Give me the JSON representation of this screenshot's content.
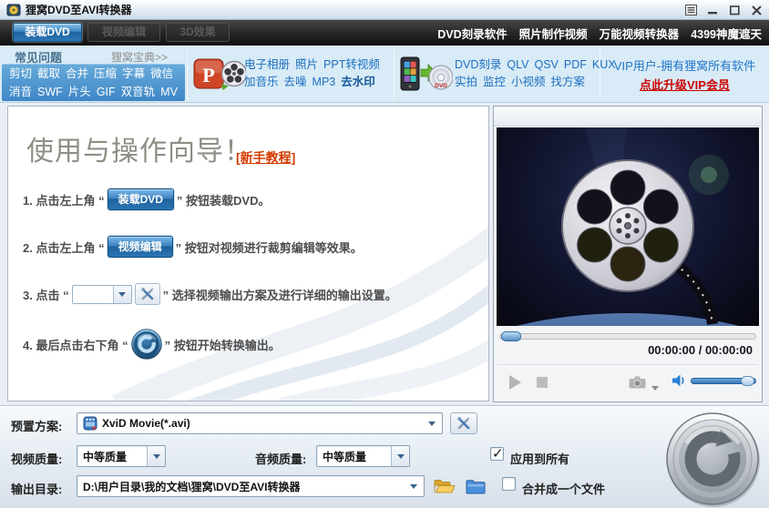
{
  "window": {
    "title": "狸窝DVD至AVI转换器"
  },
  "toolbar": {
    "tabs": [
      {
        "label": "装载DVD",
        "state": "active"
      },
      {
        "label": "视频编辑",
        "state": "disabled"
      },
      {
        "label": "3D效果",
        "state": "disabled"
      }
    ],
    "links": [
      {
        "label": "DVD刻录软件"
      },
      {
        "label": "照片制作视频"
      },
      {
        "label": "万能视频转换器"
      },
      {
        "label": "4399神魔遮天"
      }
    ]
  },
  "quickbar": {
    "faq": {
      "header": "常见问题",
      "more_link": "狸窝宝典>>",
      "links_row1": [
        {
          "label": "剪切"
        },
        {
          "label": "截取"
        },
        {
          "label": "合并"
        },
        {
          "label": "压缩"
        },
        {
          "label": "字幕"
        },
        {
          "label": "微信"
        }
      ],
      "links_row2": [
        {
          "label": "消音"
        },
        {
          "label": "SWF"
        },
        {
          "label": "片头"
        },
        {
          "label": "GIF"
        },
        {
          "label": "双音轨"
        },
        {
          "label": "MV"
        }
      ]
    },
    "photo_tools": {
      "links_row1": [
        {
          "label": "电子相册"
        },
        {
          "label": "照片"
        },
        {
          "label": "PPT转视频"
        }
      ],
      "links_row2": [
        {
          "label": "加音乐"
        },
        {
          "label": "去噪"
        },
        {
          "label": "MP3"
        },
        {
          "label": "去水印",
          "bold": true
        }
      ]
    },
    "video_tools": {
      "links_row1": [
        {
          "label": "DVD刻录"
        },
        {
          "label": "QLV"
        },
        {
          "label": "QSV"
        },
        {
          "label": "PDF"
        },
        {
          "label": "KUX"
        }
      ],
      "links_row2": [
        {
          "label": "实拍"
        },
        {
          "label": "监控"
        },
        {
          "label": "小视频"
        },
        {
          "label": "找方案"
        }
      ]
    },
    "vip": {
      "line1": "VIP用户-拥有狸窝所有软件",
      "upgrade_link": "点此升级VIP会员"
    }
  },
  "guide": {
    "title": "使用与操作向导！",
    "tutorial_link": "[新手教程]",
    "steps": [
      {
        "prefix": "1. 点击左上角 “",
        "widget": "装载DVD",
        "suffix": "” 按钮装载DVD。"
      },
      {
        "prefix": "2. 点击左上角 “",
        "widget": "视频编辑",
        "suffix": "” 按钮对视频进行裁剪编辑等效果。"
      },
      {
        "prefix": "3. 点击 “",
        "suffix": "” 选择视频输出方案及进行详细的输出设置。"
      },
      {
        "prefix": "4. 最后点击右下角 “",
        "suffix": "” 按钮开始转换输出。"
      }
    ]
  },
  "player": {
    "time_display": "00:00:00 / 00:00:00",
    "seek_position": 0,
    "volume_level": 100
  },
  "output": {
    "preset_label": "预置方案:",
    "preset_value": "XviD Movie(*.avi)",
    "video_quality_label": "视频质量:",
    "video_quality_value": "中等质量",
    "audio_quality_label": "音频质量:",
    "audio_quality_value": "中等质量",
    "apply_all": {
      "label": "应用到所有",
      "checked": true
    },
    "output_dir_label": "输出目录:",
    "output_dir_value": "D:\\用户目录\\我的文档\\狸窝\\DVD至AVI转换器",
    "merge": {
      "label": "合并成一个文件",
      "checked": false
    }
  },
  "colors": {
    "accent_blue": "#2e7cb8",
    "link_blue": "#1d6fc0",
    "vip_red": "#cc0000",
    "tutorial_orange": "#d23c00",
    "toolbar_bg": "#1a1a1a",
    "quickbar_bg": "#d8ebf6"
  }
}
